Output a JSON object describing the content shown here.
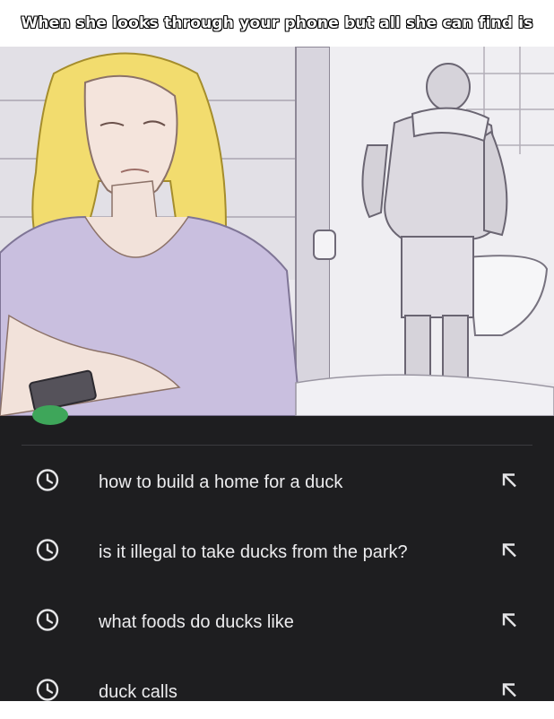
{
  "caption": "When she looks through your phone but all she can find is",
  "suggestions": [
    {
      "text": "how to build a home for a duck",
      "icon": "history-clock-icon",
      "action_icon": "fill-query-arrow-icon"
    },
    {
      "text": "is it illegal to take ducks from the park?",
      "icon": "history-clock-icon",
      "action_icon": "fill-query-arrow-icon"
    },
    {
      "text": "what foods do ducks like",
      "icon": "history-clock-icon",
      "action_icon": "fill-query-arrow-icon"
    },
    {
      "text": "duck calls",
      "icon": "history-clock-icon",
      "action_icon": "fill-query-arrow-icon"
    }
  ],
  "colors": {
    "panel_background": "#1e1e20",
    "text": "#ececee",
    "hair": "#f2dc6e",
    "shirt": "#c9bfdf"
  }
}
